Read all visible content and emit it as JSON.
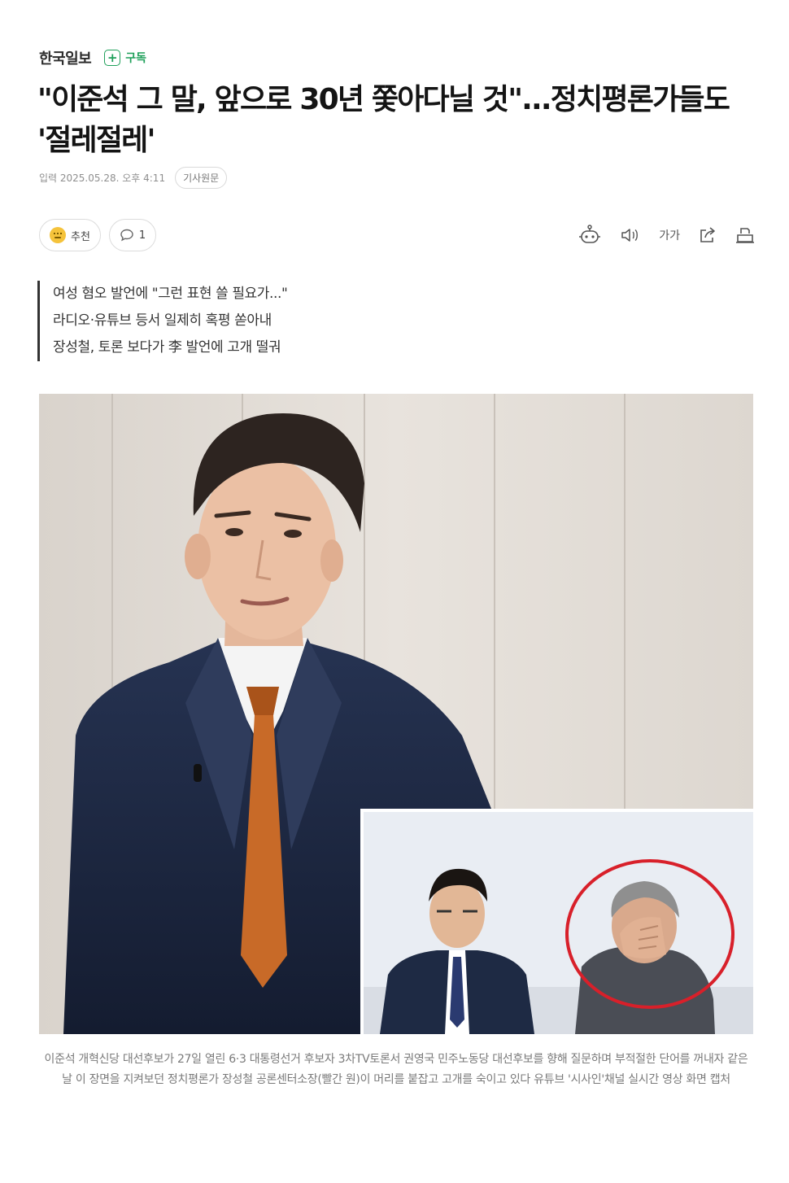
{
  "publisher": {
    "name": "한국일보",
    "subscribe_label": "구독",
    "subscribe_icon": "plus-icon"
  },
  "article": {
    "title": "\"이준석 그 말, 앞으로 30년 쫓아다닐 것\"...정치평론가들도 '절레절레'",
    "date_line": "입력 2025.05.28. 오후 4:11",
    "original_label": "기사원문"
  },
  "actions": {
    "recommend_label": "추천",
    "comment_count": "1"
  },
  "tools": {
    "font_size_label": "가가"
  },
  "summary": [
    "여성 혐오 발언에 \"그런 표현 쓸 필요가...\"",
    "라디오·유튜브 등서 일제히 혹평 쏟아내",
    "장성철, 토론 보다가 李 발언에 고개 떨궈"
  ],
  "photo": {
    "caption": "이준석 개혁신당 대선후보가 27일 열린 6·3 대통령선거 후보자 3차TV토론서 권영국 민주노동당 대선후보를 향해 질문하며 부적절한 단어를 꺼내자 같은 날 이 장면을 지켜보던 정치평론가 장성철 공론센터소장(빨간 원)이 머리를 붙잡고 고개를 숙이고 있다 유튜브 '시사인'채널 실시간 영상 화면 캡처"
  },
  "colors": {
    "accent_green": "#1fa05a",
    "highlight_circle": "#d8202a",
    "tie_orange": "#c86a28",
    "suit_navy": "#1e2a44"
  }
}
